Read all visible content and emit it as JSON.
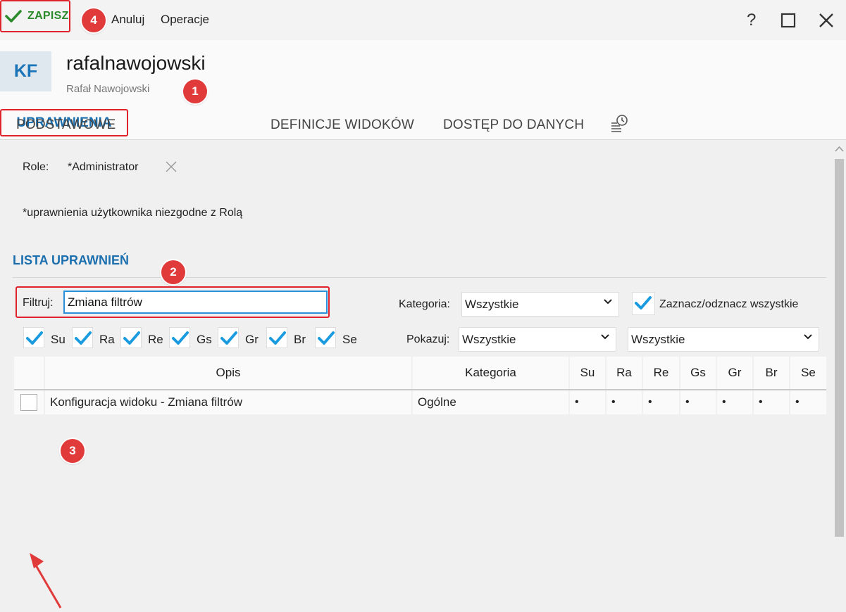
{
  "toolbar": {
    "save_label": "ZAPISZ",
    "cancel_label": "Anuluj",
    "operations_label": "Operacje",
    "help_glyph": "?",
    "colors": {
      "save_text": "#2b8a2b",
      "highlight": "#e0222d"
    }
  },
  "header": {
    "avatar_initials": "KF",
    "login": "rafalnawojowski",
    "full_name": "Rafał Nawojowski"
  },
  "tabs": [
    {
      "label": "PODSTAWOWE"
    },
    {
      "label": "UPRAWNIENIA",
      "active": true
    },
    {
      "label": "DEFINICJE WIDOKÓW"
    },
    {
      "label": "DOSTĘP DO DANYCH"
    },
    {
      "icon": "history-icon"
    }
  ],
  "roles": {
    "label": "Role:",
    "value": "*Administrator",
    "note": "*uprawnienia użytkownika niezgodne z Rolą"
  },
  "permissions": {
    "title": "LISTA UPRAWNIEŃ",
    "filter_label": "Filtruj:",
    "filter_value": "Zmiana filtrów",
    "category_label": "Kategoria:",
    "category_value": "Wszystkie",
    "select_all_label": "Zaznacz/odznacz wszystkie",
    "show_label": "Pokazuj:",
    "show_value": "Wszystkie",
    "show_value2": "Wszystkie",
    "flags": [
      "Su",
      "Ra",
      "Re",
      "Gs",
      "Gr",
      "Br",
      "Se"
    ],
    "columns": [
      "Opis",
      "Kategoria",
      "Su",
      "Ra",
      "Re",
      "Gs",
      "Gr",
      "Br",
      "Se"
    ],
    "rows": [
      {
        "checked": false,
        "opis": "Konfiguracja widoku - Zmiana filtrów",
        "kategoria": "Ogólne",
        "su": "•",
        "ra": "•",
        "re": "•",
        "gs": "•",
        "gr": "•",
        "br": "•",
        "se": "•"
      }
    ]
  },
  "annotations": [
    "1",
    "2",
    "3",
    "4"
  ],
  "colors": {
    "accent": "#1b6fae",
    "check": "#1a9be0",
    "badge": "#e03a3a"
  }
}
